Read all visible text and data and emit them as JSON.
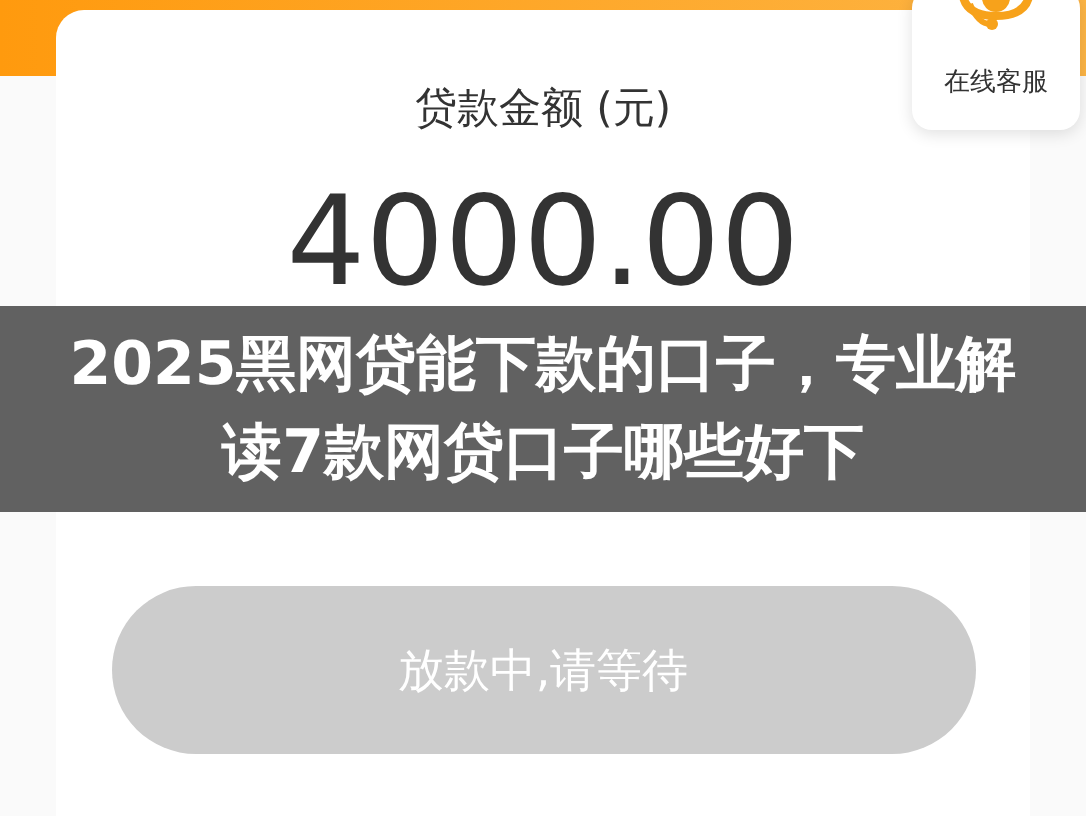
{
  "loan_card": {
    "label": "贷款金额 (元)",
    "amount": "4000.00",
    "status_button": {
      "label": "放款中,请等待",
      "disabled": true
    }
  },
  "customer_service": {
    "label": "在线客服"
  },
  "headline": "2025黑网贷能下款的口子，专业解读7款网贷口子哪些好下"
}
